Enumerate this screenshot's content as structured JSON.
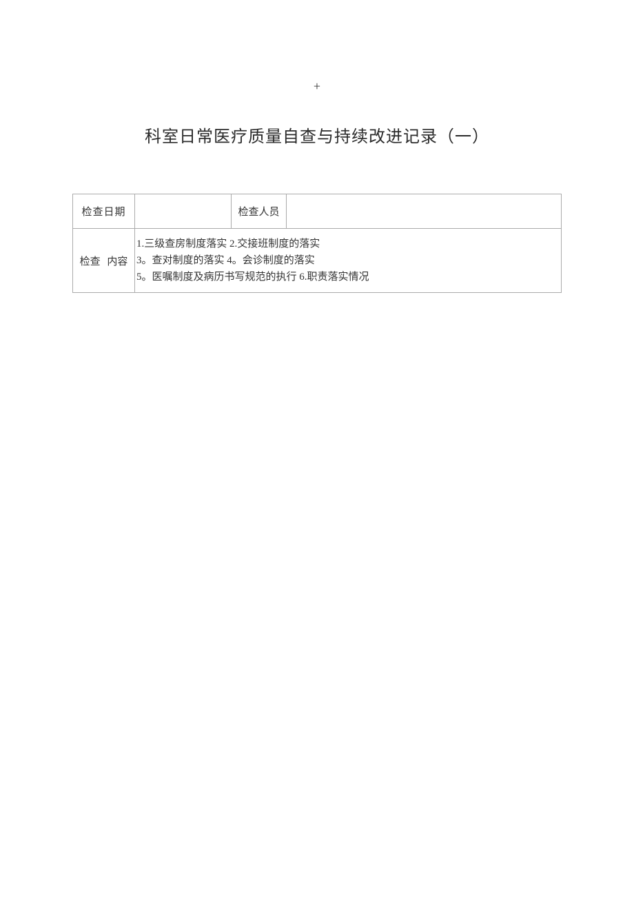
{
  "page_marker": "+",
  "title": "科室日常医疗质量自查与持续改进记录（一）",
  "row1": {
    "date_label": "检查日期",
    "date_value": "",
    "inspector_label": "检查人员",
    "inspector_value": ""
  },
  "row2": {
    "content_label": "检查  内容",
    "content_line1": "1.三级查房制度落实 2.交接班制度的落实",
    "content_line2": "3。查对制度的落实 4。会诊制度的落实",
    "content_line3": "5。医嘱制度及病历书写规范的执行 6.职责落实情况"
  }
}
